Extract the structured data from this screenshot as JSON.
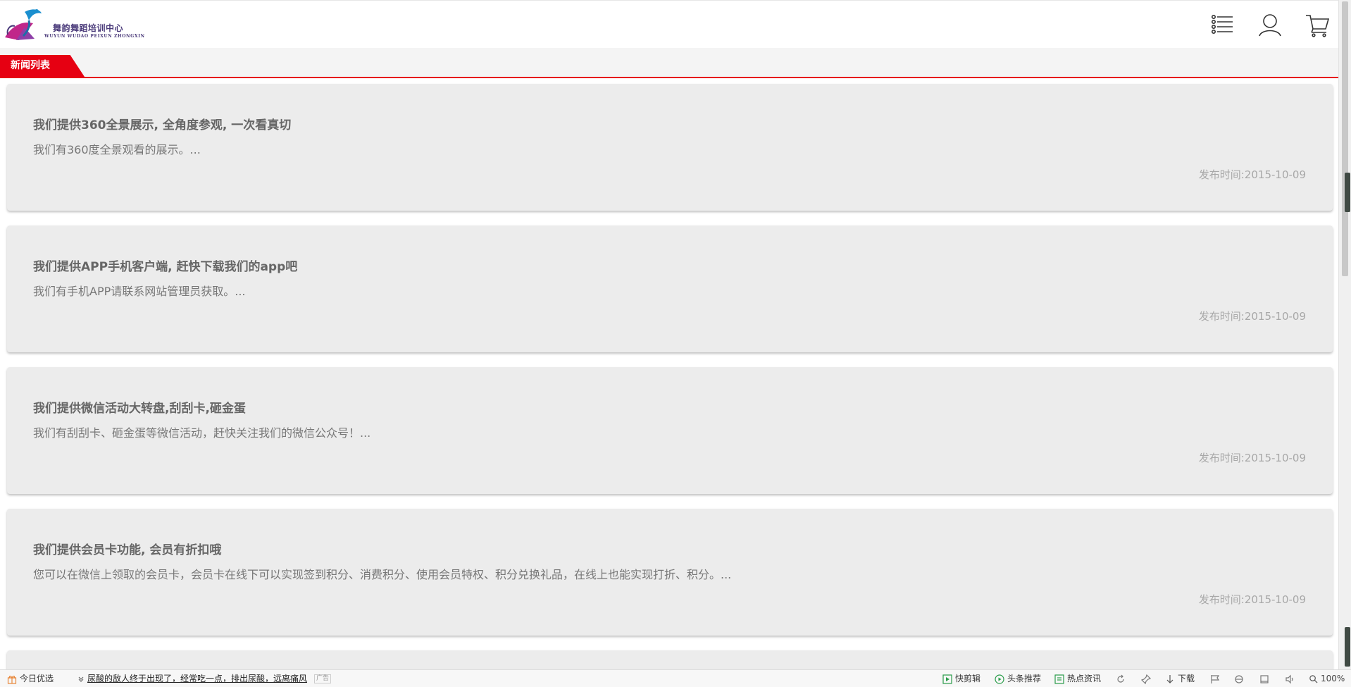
{
  "header": {
    "logo_cn": "舞韵舞蹈培训中心",
    "logo_en": "WUYUN WUDAO PEIXUN ZHONGXIN",
    "icons": [
      "list-menu-icon",
      "user-icon",
      "cart-icon"
    ]
  },
  "tabs": {
    "active_label": "新闻列表"
  },
  "news": [
    {
      "title": "我们提供360全景展示, 全角度参观, 一次看真切",
      "summary": "我们有360度全景观看的展示。...",
      "date": "发布时间:2015-10-09"
    },
    {
      "title": "我们提供APP手机客户端, 赶快下载我们的app吧",
      "summary": "我们有手机APP请联系网站管理员获取。...",
      "date": "发布时间:2015-10-09"
    },
    {
      "title": "我们提供微信活动大转盘,刮刮卡,砸金蛋",
      "summary": "我们有刮刮卡、砸金蛋等微信活动，赶快关注我们的微信公众号！...",
      "date": "发布时间:2015-10-09"
    },
    {
      "title": "我们提供会员卡功能, 会员有折扣哦",
      "summary": "您可以在微信上领取的会员卡，会员卡在线下可以实现签到积分、消费积分、使用会员特权、积分兑换礼品，在线上也能实现打折、积分。...",
      "date": "发布时间:2015-10-09"
    }
  ],
  "status_bar": {
    "today_pick": "今日优选",
    "headline": "尿酸的敌人终于出现了，经常吃一点，排出尿酸，远离痛风",
    "ad_tag": "广告",
    "clip": "快剪辑",
    "headline_rec": "头条推荐",
    "hot_news": "热点资讯",
    "download": "下载",
    "zoom": "100%"
  },
  "colors": {
    "accent": "#e60012",
    "card_bg": "#ececec",
    "logo_purple": "#4a3a7a"
  }
}
